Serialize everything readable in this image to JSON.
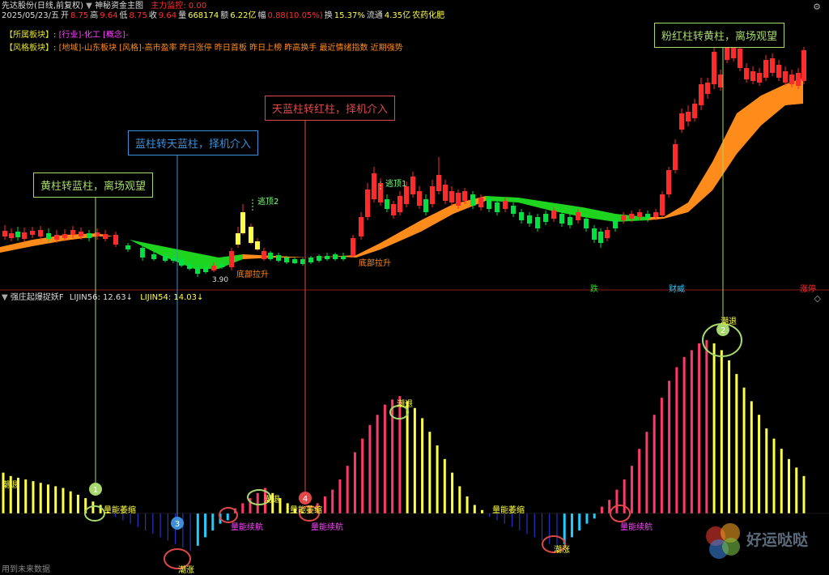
{
  "header": {
    "stock_title": "先达股份(日线,前复权)",
    "indicator_name": "神秘资金主图",
    "main_fund_label": "主力监控: 0.00",
    "date": "2025/05/23/五",
    "open_label": "开",
    "open": "8.75",
    "high_label": "高",
    "high": "9.64",
    "low_label": "低",
    "low": "8.75",
    "close_label": "收",
    "close": "9.64",
    "volume_label": "量",
    "volume": "668174",
    "amount_label": "额",
    "amount": "6.22亿",
    "change_label": "幅",
    "change": "0.88(10.05%)",
    "turnover_label": "换",
    "turnover": "15.37%",
    "float_label": "流通",
    "float": "4.35亿",
    "industry": "农药化肥"
  },
  "sectors": {
    "belong_label": "【所属板块】:",
    "belong_value": "[行业]-化工 [概念]-",
    "style_label": "【风格板块】:",
    "style_value": "[地域]-山东板块 [风格]-高市盈率 昨日涨停 昨日首板 昨日上榜 昨高换手 最近情绪指数 近期强势"
  },
  "callouts": {
    "c1": "黄柱转蓝柱，离场观望",
    "c2": "蓝柱转天蓝柱，择机介入",
    "c3": "天蓝柱转红柱，择机介入",
    "c4": "粉红柱转黄柱，离场观望"
  },
  "annotations": {
    "escape_top": "逃顶",
    "escape_top1": "逃顶1",
    "escape_top2": "逃顶2",
    "bottom_lift": "底部拉升",
    "low_price": "3.90",
    "fall": "跌",
    "fin_wei": "财威",
    "limit_up": "涨停"
  },
  "sub": {
    "title": "强庄起爆捉妖F",
    "lijin56": "LIJIN56: 12.63↓",
    "lijin54": "LIJIN54: 14.03↓",
    "ebb": "潮退",
    "shrink": "量能萎缩",
    "continue": "量能续航",
    "rising": "潮涨",
    "markers": [
      "1",
      "2",
      "3",
      "4"
    ]
  },
  "footer": {
    "note": "用到未来数据"
  },
  "watermark": {
    "text": "好运哒哒"
  },
  "colors": {
    "up": "#ff2a2a",
    "down": "#00e040",
    "band_orange": "#ff8c1a",
    "band_green": "#1ed41e",
    "yellow": "#ffff44",
    "pink": "#ff3a6a",
    "blue": "#2233cc",
    "skyblue": "#22ccff",
    "callout_green": "#a6d86b",
    "callout_blue": "#3b8fd8",
    "callout_red": "#e04848"
  },
  "chart_data": {
    "type": "bar",
    "series": [
      {
        "name": "LIJIN56",
        "values": [
          12,
          11,
          10.5,
          10,
          9.5,
          9,
          8.5,
          8,
          7.5,
          6.5,
          5.5,
          4.5,
          3.5,
          2.5,
          0.5,
          -1,
          -2,
          -3,
          -4,
          -5,
          -6,
          -7,
          -8,
          -9,
          -10,
          -11,
          -9.5,
          -7,
          -5,
          -3,
          -2,
          1.5,
          3,
          4.5,
          6,
          7.5,
          6,
          4.5,
          3,
          1.5,
          0.5,
          1.5,
          3,
          5,
          7,
          10,
          14,
          18,
          22,
          26,
          29,
          32,
          33.5,
          34.5,
          33,
          31,
          28,
          24,
          20,
          16,
          12,
          8,
          5,
          2.5,
          1,
          -1,
          -2,
          -3,
          -4,
          -5,
          -6,
          -7,
          -8,
          -9,
          -10,
          -9,
          -7,
          -5,
          -3,
          -1.5,
          2,
          4,
          7,
          10,
          14,
          19,
          24,
          29,
          34,
          39,
          43,
          46,
          48,
          50,
          51,
          50,
          48,
          45,
          41,
          37,
          33,
          29,
          25,
          22,
          19,
          16,
          13.5,
          11
        ]
      }
    ]
  }
}
